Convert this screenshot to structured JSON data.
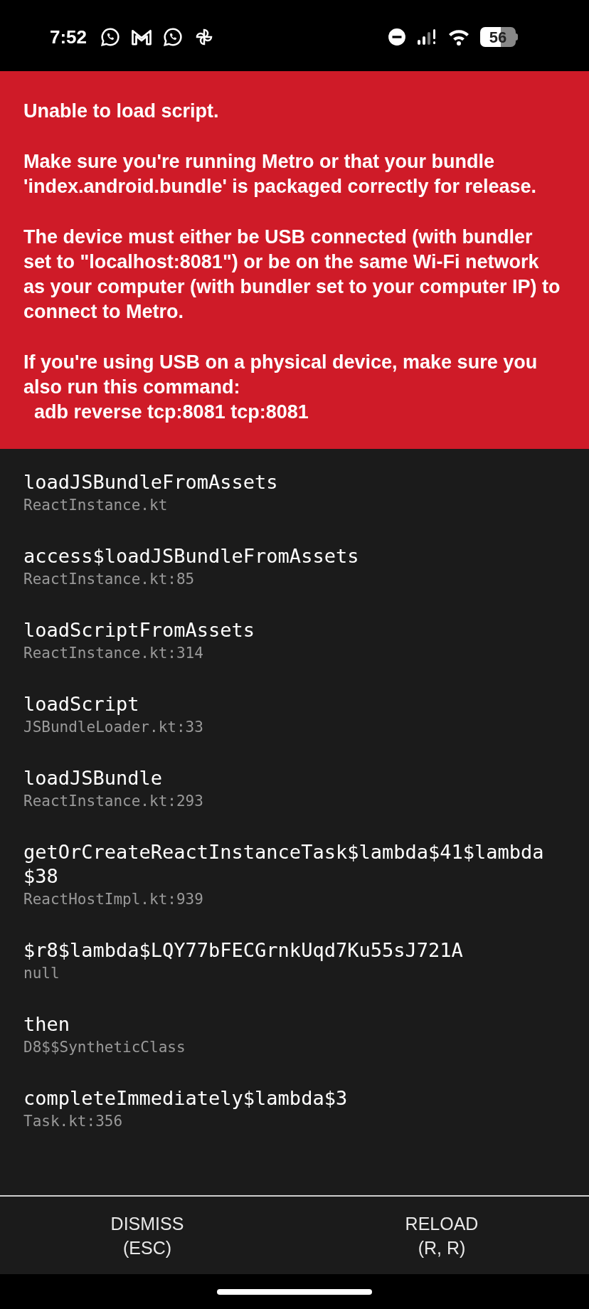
{
  "status_bar": {
    "time": "7:52",
    "battery": "56"
  },
  "error": {
    "paragraphs": [
      "Unable to load script.",
      "Make sure you're running Metro or that your bundle 'index.android.bundle' is packaged correctly for release.",
      "The device must either be USB connected (with bundler set to \"localhost:8081\") or be on the same Wi-Fi network as your computer (with bundler set to your computer IP) to connect to Metro.",
      "If you're using USB on a physical device, make sure you also run this command:\n  adb reverse tcp:8081 tcp:8081"
    ]
  },
  "stack": [
    {
      "method": "loadJSBundleFromAssets",
      "file": "ReactInstance.kt"
    },
    {
      "method": "access$loadJSBundleFromAssets",
      "file": "ReactInstance.kt:85"
    },
    {
      "method": "loadScriptFromAssets",
      "file": "ReactInstance.kt:314"
    },
    {
      "method": "loadScript",
      "file": "JSBundleLoader.kt:33"
    },
    {
      "method": "loadJSBundle",
      "file": "ReactInstance.kt:293"
    },
    {
      "method": "getOrCreateReactInstanceTask$lambda$41$lambda$38",
      "file": "ReactHostImpl.kt:939"
    },
    {
      "method": "$r8$lambda$LQY77bFECGrnkUqd7Ku55sJ721A",
      "file": "null"
    },
    {
      "method": "then",
      "file": "D8$$SyntheticClass"
    },
    {
      "method": "completeImmediately$lambda$3",
      "file": "Task.kt:356"
    }
  ],
  "buttons": [
    {
      "label": "DISMISS",
      "shortcut": "(ESC)"
    },
    {
      "label": "RELOAD",
      "shortcut": "(R, R)"
    }
  ]
}
